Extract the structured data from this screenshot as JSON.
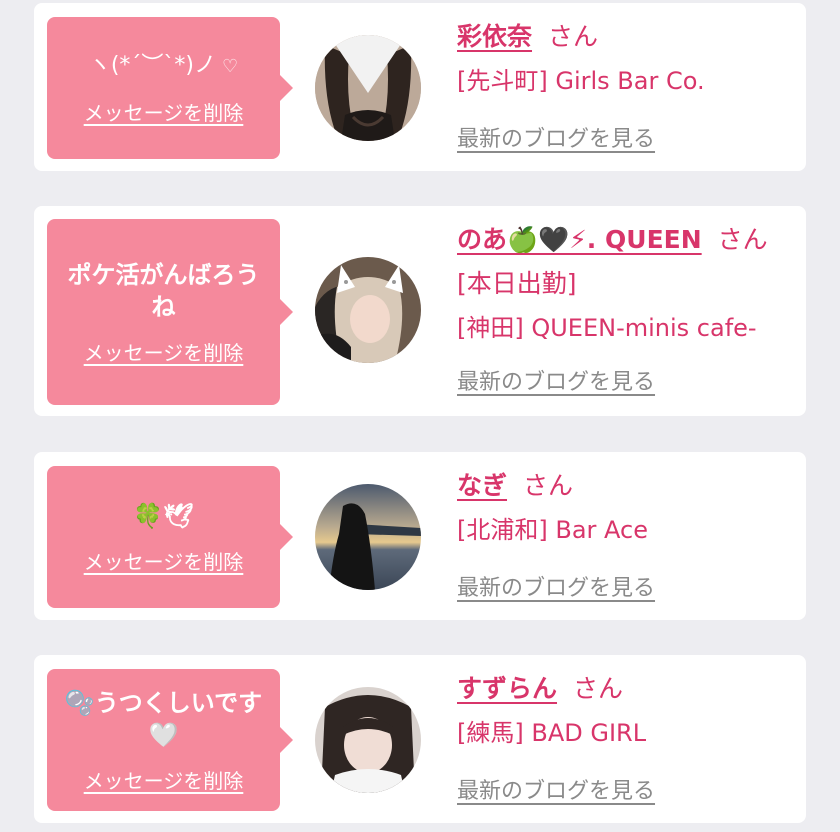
{
  "messages": [
    {
      "message": "ヽ(*´︶`*)ノ",
      "heart": "♡",
      "delete_label": "メッセージを削除",
      "name": "彩依奈",
      "honorific": "さん",
      "shop": "[先斗町] Girls Bar Co.",
      "blog_label": "最新のブログを見る"
    },
    {
      "message": "ポケ活がんばろうね",
      "delete_label": "メッセージを削除",
      "name": "のあ🍏🖤⚡︎. QUEEN",
      "honorific": "さん",
      "status": "[本日出勤]",
      "shop": "[神田] QUEEN-minis cafe-",
      "blog_label": "最新のブログを見る"
    },
    {
      "message": "🍀🕊",
      "delete_label": "メッセージを削除",
      "name": "なぎ",
      "honorific": "さん",
      "shop": "[北浦和] Bar Ace",
      "blog_label": "最新のブログを見る"
    },
    {
      "message": "🫧うつくしいです🤍",
      "delete_label": "メッセージを削除",
      "name": "すずらん",
      "honorific": "さん",
      "shop": "[練馬] BAD GIRL",
      "blog_label": "最新のブログを見る"
    }
  ]
}
